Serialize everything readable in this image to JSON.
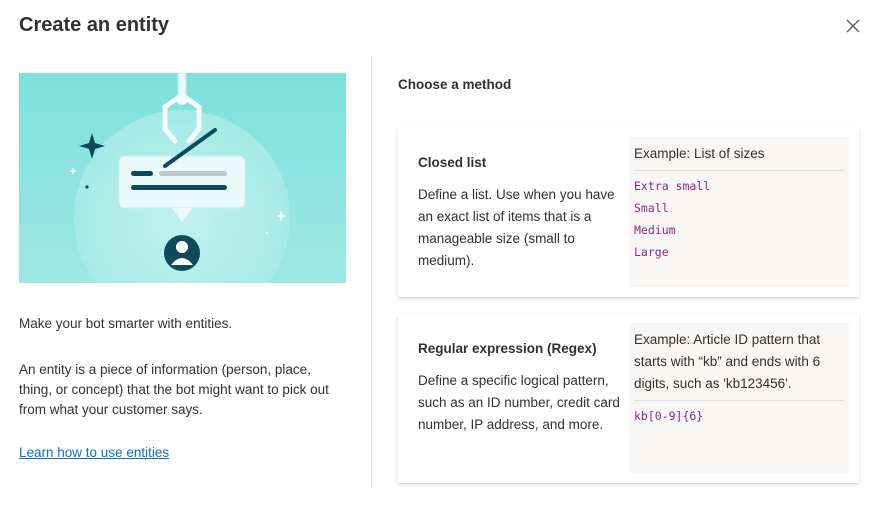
{
  "dialog": {
    "title": "Create an entity"
  },
  "left": {
    "intro": "Make your bot smarter with entities.",
    "description": "An entity is a piece of information (person, place, thing, or concept) that the bot might want to pick out from what your customer says.",
    "link": "Learn how to use entities"
  },
  "right": {
    "heading": "Choose a method",
    "methods": [
      {
        "title": "Closed list",
        "description": "Define a list. Use when you have an exact list of items that is a manageable size (small to medium).",
        "example_title": "Example: List of sizes",
        "example_items": [
          "Extra small",
          "Small",
          "Medium",
          "Large"
        ]
      },
      {
        "title": "Regular expression (Regex)",
        "description": "Define a specific logical pattern, such as an ID number, credit card number, IP address, and more.",
        "example_title": "Example: Article ID pattern that starts with “kb” and ends with 6 digits, such as 'kb123456'.",
        "example_items": [
          "kb[0-9]{6}"
        ]
      }
    ]
  },
  "icons": {
    "close": "close-icon",
    "illustration": "entity-illustration"
  },
  "colors": {
    "illustration_bg": "#7ee0dc",
    "accent_dark": "#0f4a5c",
    "link": "#106ebe",
    "example_value": "#8a2a86",
    "example_bg": "#f8f7f5"
  }
}
